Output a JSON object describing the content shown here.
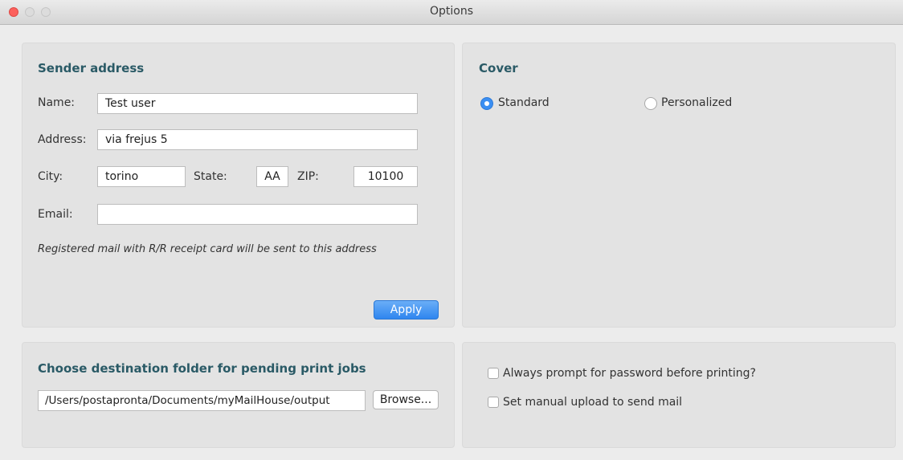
{
  "window": {
    "title": "Options"
  },
  "sender": {
    "heading": "Sender address",
    "name_label": "Name:",
    "name_value": "Test user",
    "address_label": "Address:",
    "address_value": "via frejus 5",
    "city_label": "City:",
    "city_value": "torino",
    "state_label": "State:",
    "state_value": "AA",
    "zip_label": "ZIP:",
    "zip_value": "10100",
    "email_label": "Email:",
    "email_value": "",
    "note": "Registered mail with R/R receipt card will be sent to this address",
    "apply_label": "Apply"
  },
  "cover": {
    "heading": "Cover",
    "options": [
      {
        "label": "Standard",
        "selected": true
      },
      {
        "label": "Personalized",
        "selected": false
      }
    ]
  },
  "destination": {
    "heading": "Choose destination folder for pending print jobs",
    "path": "/Users/postapronta/Documents/myMailHouse/output",
    "browse_label": "Browse..."
  },
  "options": {
    "items": [
      {
        "label": "Always prompt for password before printing?",
        "checked": false
      },
      {
        "label": "Set manual upload to send mail",
        "checked": false
      }
    ]
  },
  "colors": {
    "accent": "#3b8ff2",
    "heading": "#2a5a66",
    "close_button": "#fc605c"
  }
}
